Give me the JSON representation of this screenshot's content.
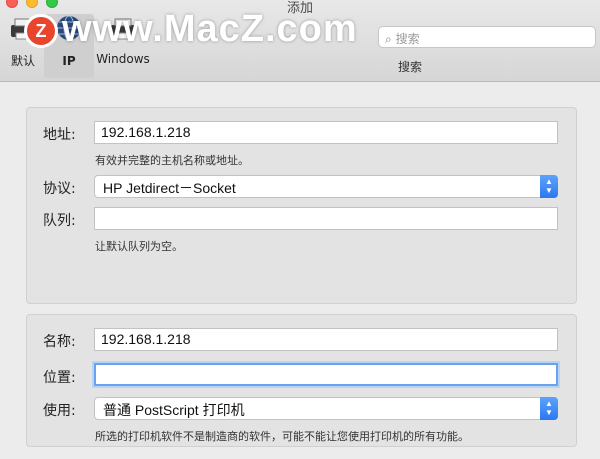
{
  "window": {
    "title": "添加",
    "watermark": "www.MacZ.com",
    "watermark_logo": "Z"
  },
  "toolbar": {
    "items": [
      {
        "label": "默认",
        "icon": "printer-default-icon"
      },
      {
        "label": "IP",
        "icon": "globe-network-icon",
        "selected": true
      },
      {
        "label": "Windows",
        "icon": "printer-windows-icon"
      }
    ],
    "search_placeholder": "搜索",
    "search_caption": "搜索"
  },
  "printer_setup": {
    "address_label": "地址:",
    "address_value": "192.168.1.218",
    "address_hint": "有效并完整的主机名称或地址。",
    "protocol_label": "协议:",
    "protocol_value": "HP Jetdirect－Socket",
    "queue_label": "队列:",
    "queue_value": "",
    "queue_hint": "让默认队列为空。"
  },
  "printer_info": {
    "name_label": "名称:",
    "name_value": "192.168.1.218",
    "location_label": "位置:",
    "location_value": "",
    "use_label": "使用:",
    "use_value": "普通 PostScript 打印机",
    "use_hint": "所选的打印机软件不是制造商的软件，可能不能让您使用打印机的所有功能。"
  },
  "colors": {
    "accent": "#2b78f0",
    "focus_ring": "#6aa2ec",
    "watermark_logo": "#e8452c"
  }
}
